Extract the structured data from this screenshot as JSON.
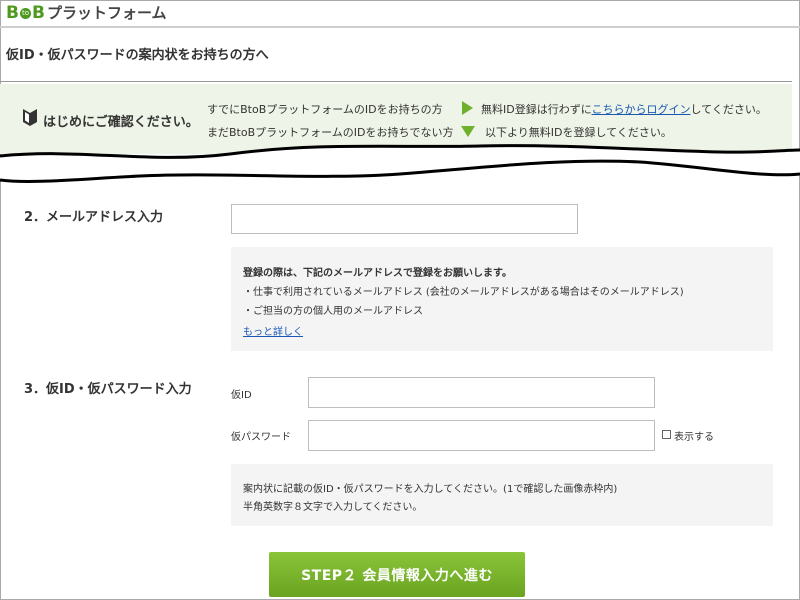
{
  "header": {
    "logo_b1": "B",
    "logo_to": "to",
    "logo_b2": "B",
    "logo_name": "プラットフォーム",
    "page_title": "仮ID・仮パスワードの案内状をお持ちの方へ"
  },
  "notice": {
    "heading": "はじめにご確認ください。",
    "line1": "すでにBtoBプラットフォームのIDをお持ちの方",
    "line2": "まだBtoBプラットフォームのIDをお持ちでない方",
    "right1_prefix": "無料ID登録は行わずに",
    "right1_link": "こちらからログイン",
    "right1_suffix": "してください。",
    "right2": "以下より無料IDを登録してください。"
  },
  "email_section": {
    "label": "2．メールアドレス入力",
    "value": "",
    "info_heading": "登録の際は、下記のメールアドレスで登録をお願いします。",
    "info_item1": "・仕事で利用されているメールアドレス (会社のメールアドレスがある場合はそのメールアドレス)",
    "info_item2": "・ご担当の方の個人用のメールアドレス",
    "info_link": "もっと詳しく"
  },
  "credentials_section": {
    "label": "3．仮ID・仮パスワード入力",
    "id_label": "仮ID",
    "id_value": "",
    "password_label": "仮パスワード",
    "password_value": "",
    "show_label": "表示する",
    "show_checked": false,
    "info_line1": "案内状に記載の仮ID・仮パスワードを入力してください。(1で確認した画像赤枠内)",
    "info_line2": "半角英数字８文字で入力してください。"
  },
  "actions": {
    "next_button": "STEP２ 会員情報入力へ進む"
  },
  "colors": {
    "brand_green": "#4d9a1e",
    "button_green": "#7ab530",
    "notice_bg": "#eef4e7",
    "link": "#1a58b4"
  }
}
